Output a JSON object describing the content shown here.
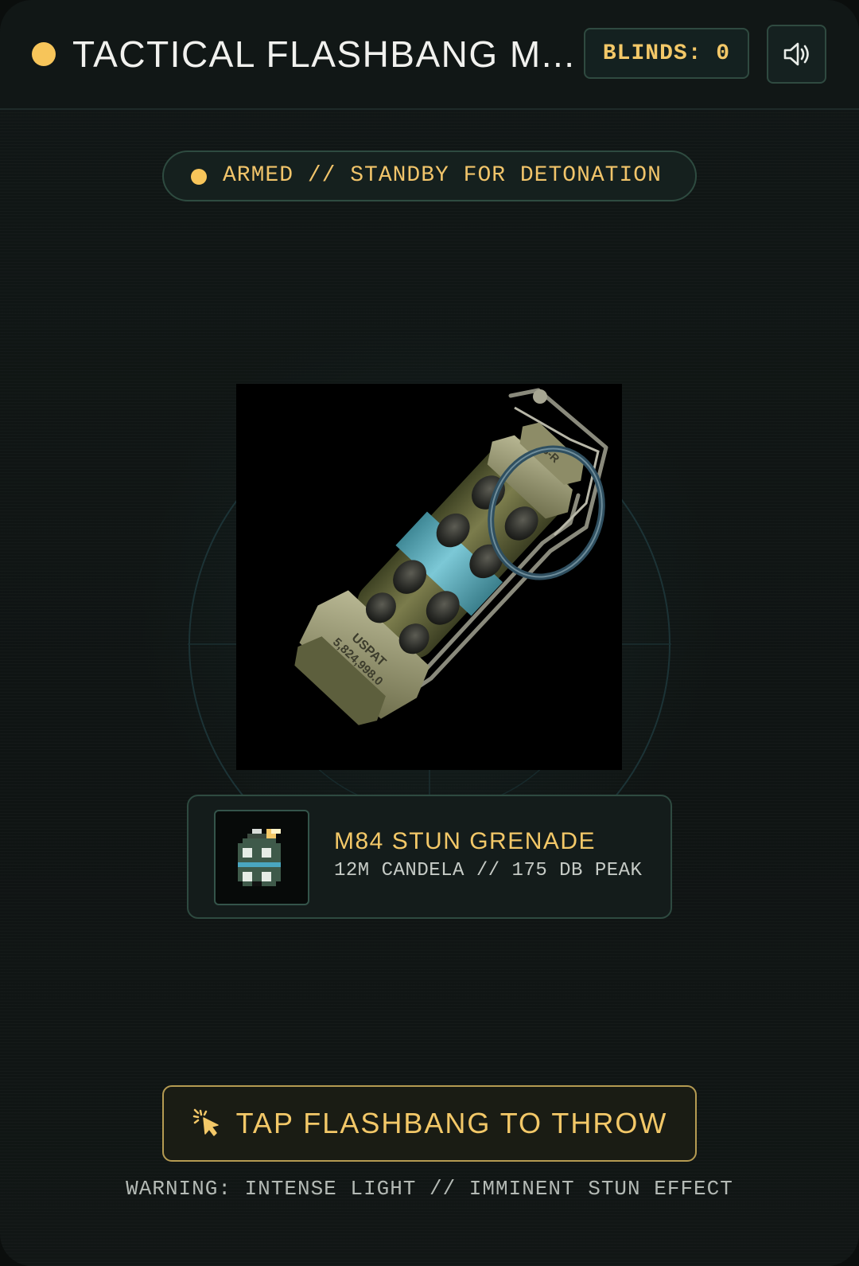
{
  "header": {
    "title": "TACTICAL FLASHBANG M...",
    "blinds_label": "BLINDS: 0",
    "sound_icon": "speaker-volume-icon"
  },
  "status": {
    "text": "ARMED // STANDBY FOR DETONATION",
    "state_color": "#f7c55a"
  },
  "grenade": {
    "stamp_line1": "USPAT",
    "stamp_line2": "5,824,998.0",
    "top_marking": "8-R"
  },
  "item": {
    "name": "M84 STUN GRENADE",
    "specs": "12M CANDELA // 175 DB PEAK",
    "thumbnail_icon": "pixel-grenade-icon"
  },
  "action": {
    "label": "TAP FLASHBANG TO THROW",
    "icon": "tap-pointer-icon"
  },
  "warning": "WARNING: INTENSE LIGHT // IMMINENT STUN EFFECT",
  "colors": {
    "accent": "#f3c868",
    "border": "#2e4a40",
    "band": "#64b8c9"
  }
}
